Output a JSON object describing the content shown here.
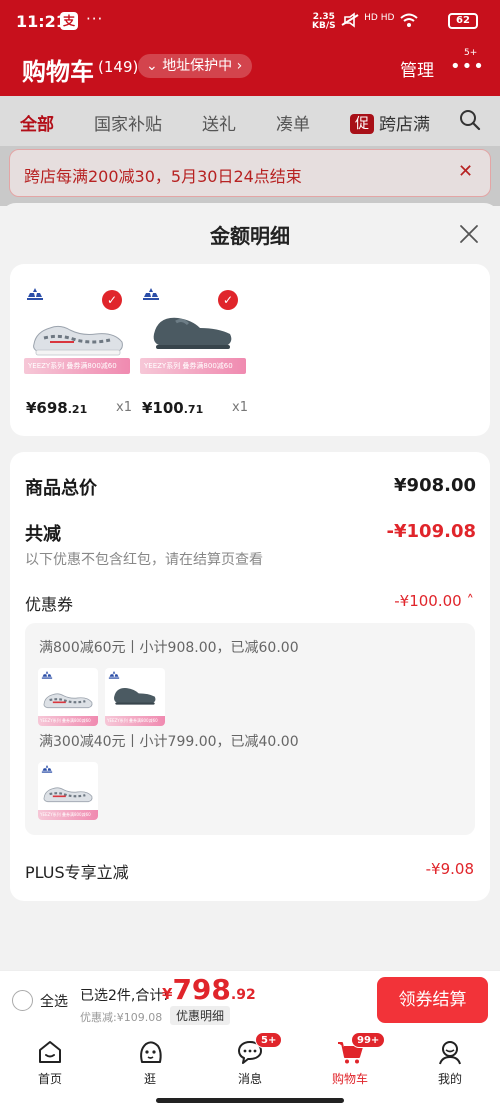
{
  "status_bar": {
    "time": "11:21",
    "app_glyph": "支",
    "dots": "···",
    "net_speed_value": "2.35",
    "net_speed_unit": "KB/S",
    "signal": "HD HD",
    "battery": "62"
  },
  "header": {
    "title": "购物车",
    "count": "(149)",
    "address_label": "地址保护中",
    "manage_label": "管理",
    "more_badge": "5+"
  },
  "tabs": [
    {
      "label": "全部",
      "active": true
    },
    {
      "label": "国家补贴"
    },
    {
      "label": "送礼"
    },
    {
      "label": "凑单"
    },
    {
      "label": "跨店满",
      "badge": "促"
    }
  ],
  "banner": {
    "text": "跨店每满200减30，5月30日24点结束"
  },
  "sheet": {
    "title": "金额明细",
    "products": [
      {
        "price_int": "¥698",
        "price_dec": ".21",
        "qty": "x1",
        "tag": "YEEZY系列 叠券满800减60"
      },
      {
        "price_int": "¥100",
        "price_dec": ".71",
        "qty": "x1",
        "tag": "YEEZY系列 叠券满800减60"
      }
    ],
    "goods_total_label": "商品总价",
    "goods_total_value": "¥908.00",
    "reduction_label": "共减",
    "reduction_value": "-¥109.08",
    "reduction_note": "以下优惠不包含红包，请在结算页查看",
    "coupon_label": "优惠券",
    "coupon_value": "-¥100.00",
    "coupon_rules": [
      "满800减60元丨小计908.00，已减60.00",
      "满300减40元丨小计799.00，已减40.00"
    ],
    "plus_label": "PLUS专享立减",
    "plus_value": "-¥9.08"
  },
  "action_bar": {
    "select_all": "全选",
    "selected_text": "已选2件,合计:",
    "total_symbol": "¥",
    "total_int": "798",
    "total_dec": ".92",
    "discount_text": "优惠减:¥109.08",
    "detail_chip": "优惠明细",
    "checkout_label": "领券结算"
  },
  "bottom_nav": [
    {
      "label": "首页",
      "icon": "home-icon"
    },
    {
      "label": "逛",
      "icon": "browse-icon"
    },
    {
      "label": "消息",
      "icon": "message-icon",
      "badge": "5+"
    },
    {
      "label": "购物车",
      "icon": "cart-icon",
      "badge": "99+",
      "active": true
    },
    {
      "label": "我的",
      "icon": "profile-icon"
    }
  ],
  "colors": {
    "brand_red": "#e0252b",
    "header_red": "#c7101c",
    "checkout_red": "#f23339"
  }
}
